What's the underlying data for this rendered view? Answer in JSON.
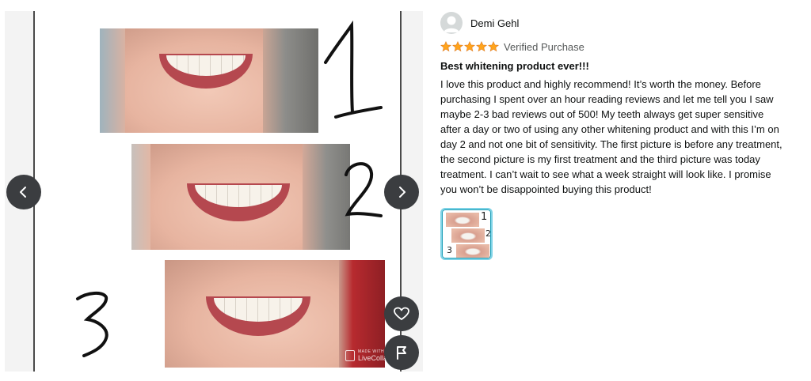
{
  "viewer": {
    "photo_labels": [
      "1",
      "2",
      "3"
    ],
    "watermark": {
      "small": "MADE WITH",
      "brand": "LiveCollage"
    }
  },
  "icons": {
    "prev": "chevron-left-icon",
    "next": "chevron-right-icon",
    "like": "heart-icon",
    "report": "flag-icon"
  },
  "review": {
    "reviewer_name": "Demi Gehl",
    "rating": 5,
    "rating_max": 5,
    "verified_label": "Verified Purchase",
    "title": "Best whitening product ever!!!",
    "body": "I love this product and highly recommend! It’s worth the money. Before purchasing I spent over an hour reading reviews and let me tell you I saw maybe 2-3 bad reviews out of 500! My teeth always get super sensitive after a day or two of using any other whitening product and with this I’m on day 2 and not one bit of sensitivity. The first picture is before any treatment, the second picture is my first treatment and the third picture was today treatment. I can’t wait to see what a week straight will look like. I promise you won’t be disappointed buying this product!"
  },
  "colors": {
    "star": "#ffa41c",
    "nav_button": "#3b3d40",
    "thumb_border": "#7fd3e6"
  }
}
